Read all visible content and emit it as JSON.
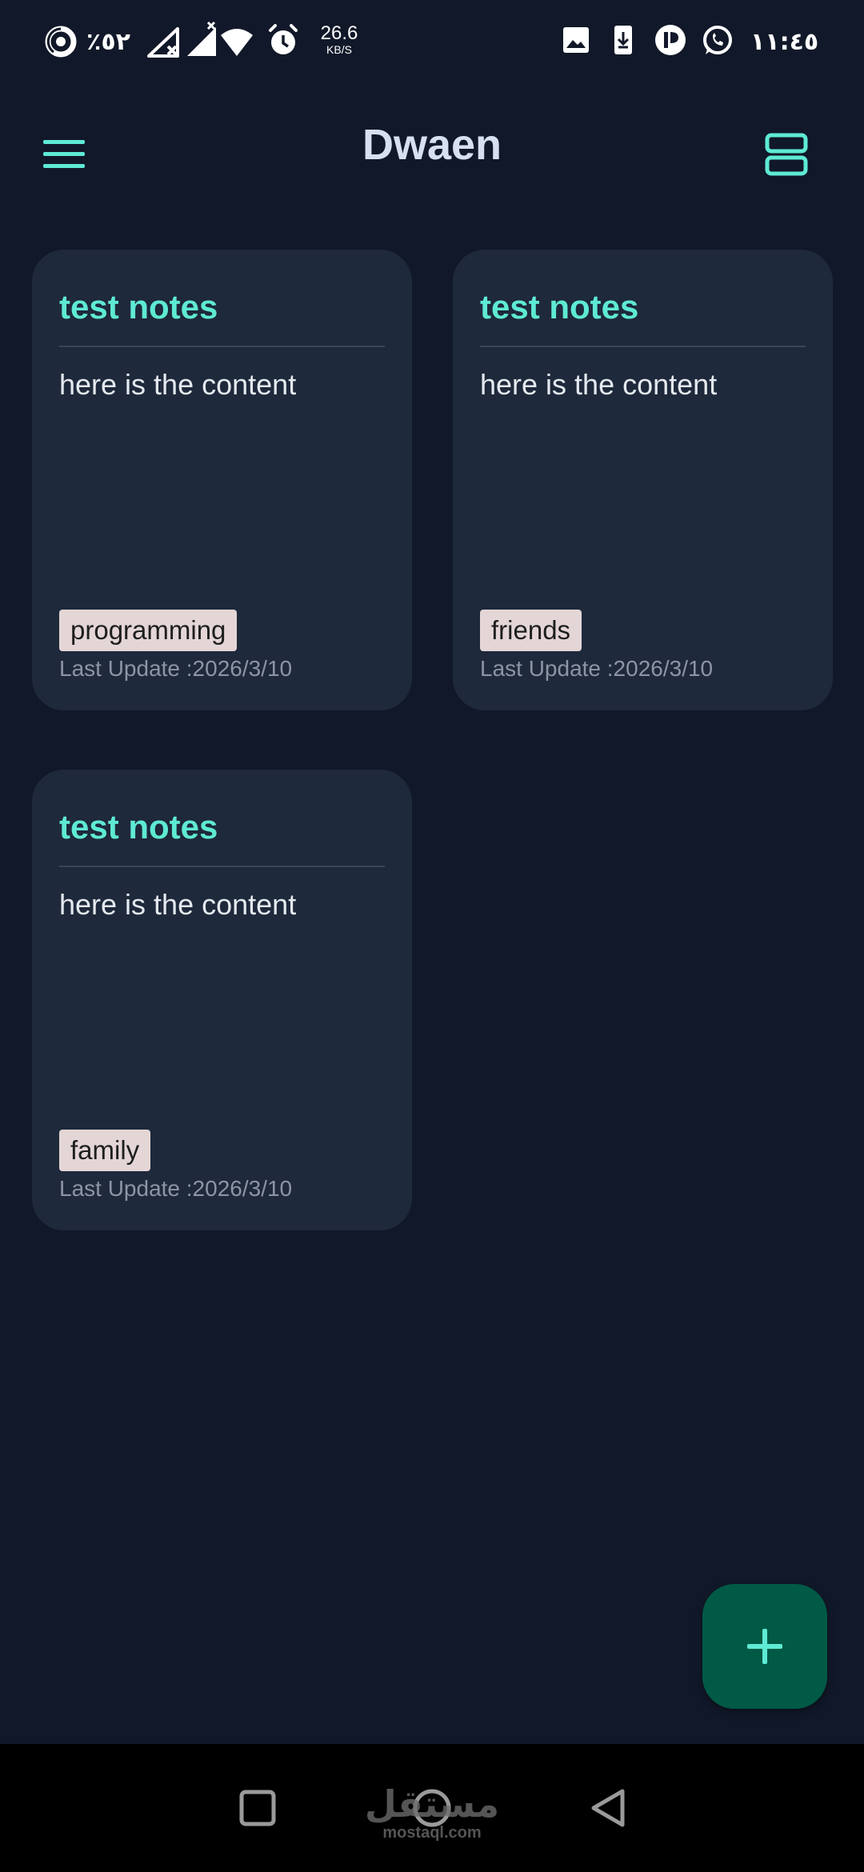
{
  "status_bar": {
    "battery_percent": "٪٥٢",
    "network_speed_value": "26.6",
    "network_speed_unit": "KB/S",
    "time": "١١:٤٥",
    "icons": [
      "battery-ring-icon",
      "signal-no-service-icon",
      "signal-icon",
      "wifi-icon",
      "alarm-icon",
      "gallery-icon",
      "download-icon",
      "app-notification-icon",
      "whatsapp-icon"
    ]
  },
  "app_bar": {
    "title": "Dwaen",
    "menu_icon": "hamburger-menu-icon",
    "view_icon": "view-agenda-icon"
  },
  "notes": [
    {
      "title": "test notes",
      "content": "here is the content",
      "tag": "programming",
      "updated": "Last Update :2026/3/10"
    },
    {
      "title": "test notes",
      "content": "here is the content",
      "tag": "friends",
      "updated": "Last Update :2026/3/10"
    },
    {
      "title": "test notes",
      "content": "here is the content",
      "tag": "family",
      "updated": "Last Update :2026/3/10"
    }
  ],
  "fab": {
    "icon": "plus-icon"
  },
  "nav_bar": {
    "recents_icon": "square-icon",
    "home_icon": "circle-icon",
    "back_icon": "triangle-back-icon"
  },
  "watermark": {
    "arabic": "مستقل",
    "latin": "mostaql.com"
  },
  "colors": {
    "background": "#111829",
    "card": "#1e293b",
    "accent": "#5eead4",
    "fab": "#005a45",
    "tag_bg": "#e4d6d6"
  }
}
